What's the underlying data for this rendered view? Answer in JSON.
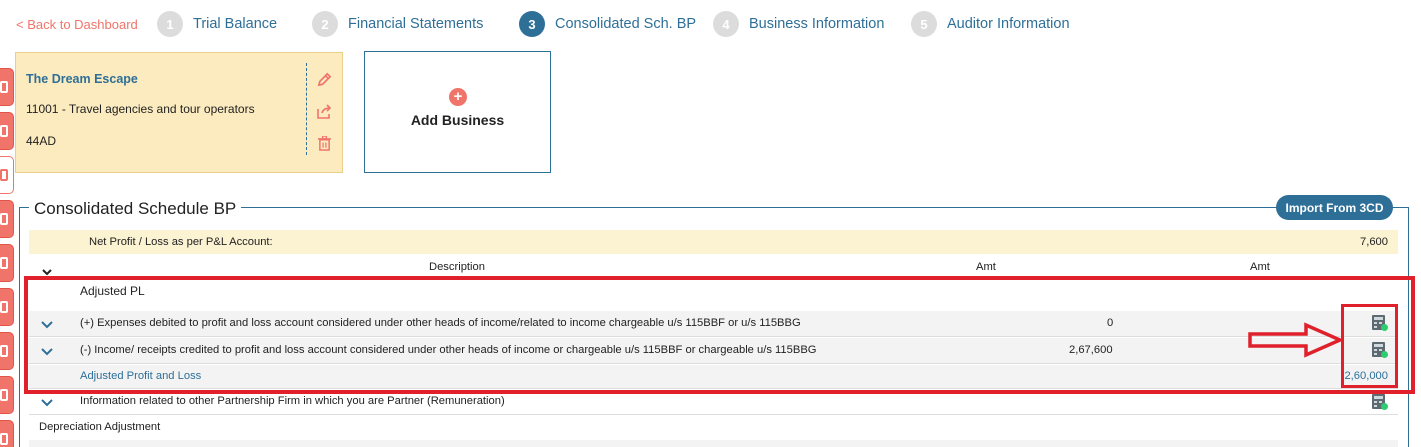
{
  "nav": {
    "back_label": "< Back to Dashboard",
    "steps": [
      {
        "num": "1",
        "label": "Trial Balance"
      },
      {
        "num": "2",
        "label": "Financial Statements"
      },
      {
        "num": "3",
        "label": "Consolidated Sch. BP"
      },
      {
        "num": "4",
        "label": "Business Information"
      },
      {
        "num": "5",
        "label": "Auditor Information"
      }
    ],
    "active_step": 3
  },
  "business_card": {
    "name": "The Dream Escape",
    "code": "11001 - Travel agencies and tour operators",
    "id": "44AD"
  },
  "add_business": {
    "label": "Add Business"
  },
  "schedule": {
    "title": "Consolidated Schedule BP",
    "import_label": "Import From 3CD",
    "net_profit": {
      "label": "Net Profit / Loss as per P&L Account:",
      "value": "7,600"
    },
    "columns": {
      "description": "Description",
      "amt1": "Amt",
      "amt2": "Amt"
    },
    "adjusted_pl_heading": "Adjusted PL",
    "rows": [
      {
        "label": "(+) Expenses debited to profit and loss account considered under other heads of income/related to income chargeable u/s 115BBF or u/s 115BBG",
        "amt1": "0"
      },
      {
        "label": "(-) Income/ receipts credited to profit and loss account considered under other heads of income or chargeable u/s 115BBF or chargeable u/s 115BBG",
        "amt1": "2,67,600"
      }
    ],
    "adjusted_total": {
      "label": "Adjusted Profit and Loss",
      "value": "2,60,000"
    },
    "partnership_row": {
      "label": "Information related to other Partnership Firm in which you are Partner (Remuneration)"
    },
    "depreciation_heading": "Depreciation Adjustment"
  },
  "colors": {
    "accent": "#2e6f98",
    "brand": "#f0746a",
    "annotation": "#e0202a"
  }
}
